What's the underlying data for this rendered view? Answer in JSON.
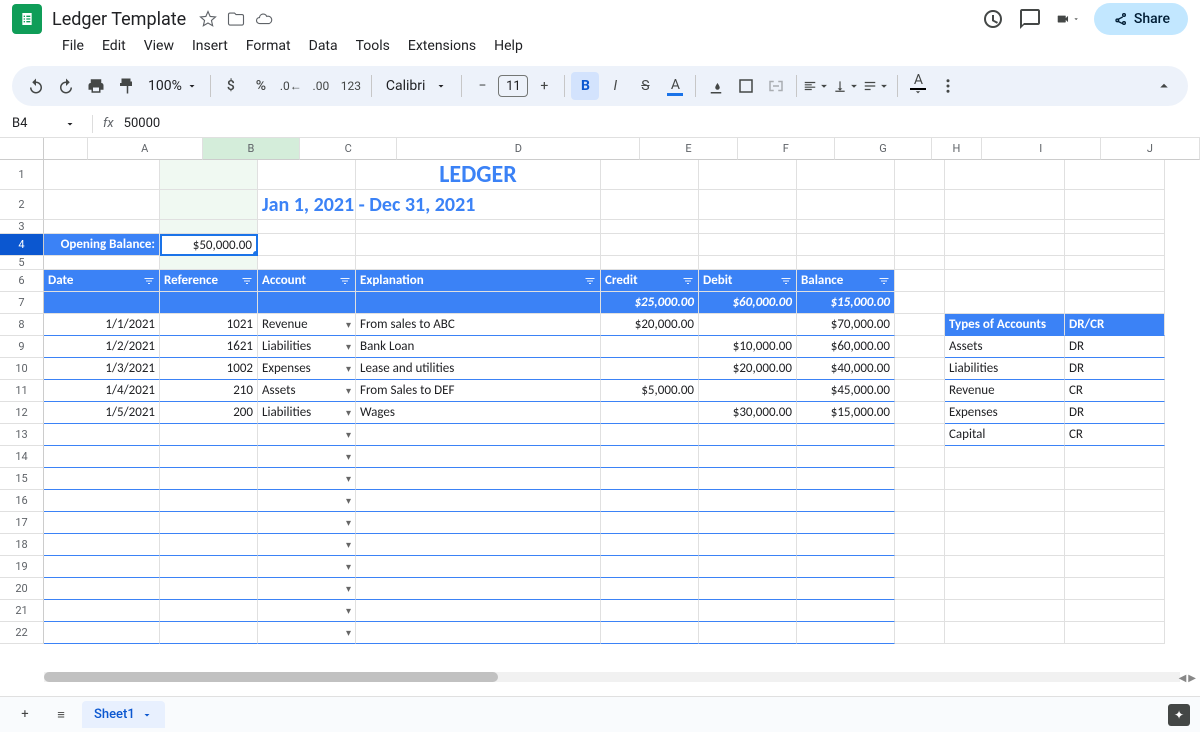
{
  "doc": {
    "title": "Ledger Template"
  },
  "menus": [
    "File",
    "Edit",
    "View",
    "Insert",
    "Format",
    "Data",
    "Tools",
    "Extensions",
    "Help"
  ],
  "toolbar": {
    "zoom": "100%",
    "font": "Calibri",
    "font_size": "11"
  },
  "share": "Share",
  "namebox": "B4",
  "formula": "50000",
  "fx": "fx",
  "cols": [
    "A",
    "B",
    "C",
    "D",
    "E",
    "F",
    "G",
    "H",
    "I",
    "J"
  ],
  "sheet": {
    "name": "Sheet1"
  },
  "content": {
    "ledger_title": "LEDGER",
    "date_range": "Jan 1, 2021 - Dec 31, 2021",
    "opening_balance_label": "Opening Balance:",
    "opening_balance_value": "$50,000.00",
    "headers": {
      "date": "Date",
      "reference": "Reference",
      "account": "Account",
      "explanation": "Explanation",
      "credit": "Credit",
      "debit": "Debit",
      "balance": "Balance"
    },
    "totals": {
      "credit": "$25,000.00",
      "debit": "$60,000.00",
      "balance": "$15,000.00"
    },
    "rows": [
      {
        "date": "1/1/2021",
        "ref": "1021",
        "account": "Revenue",
        "expl": "From sales to ABC",
        "credit": "$20,000.00",
        "debit": "",
        "balance": "$70,000.00"
      },
      {
        "date": "1/2/2021",
        "ref": "1621",
        "account": "Liabilities",
        "expl": "Bank Loan",
        "credit": "",
        "debit": "$10,000.00",
        "balance": "$60,000.00"
      },
      {
        "date": "1/3/2021",
        "ref": "1002",
        "account": "Expenses",
        "expl": "Lease and utilities",
        "credit": "",
        "debit": "$20,000.00",
        "balance": "$40,000.00"
      },
      {
        "date": "1/4/2021",
        "ref": "210",
        "account": "Assets",
        "expl": "From Sales to DEF",
        "credit": "$5,000.00",
        "debit": "",
        "balance": "$45,000.00"
      },
      {
        "date": "1/5/2021",
        "ref": "200",
        "account": "Liabilities",
        "expl": "Wages",
        "credit": "",
        "debit": "$30,000.00",
        "balance": "$15,000.00"
      }
    ],
    "side_table": {
      "h1": "Types of Accounts",
      "h2": "DR/CR",
      "rows": [
        {
          "t": "Assets",
          "v": "DR"
        },
        {
          "t": "Liabilities",
          "v": "DR"
        },
        {
          "t": "Revenue",
          "v": "CR"
        },
        {
          "t": "Expenses",
          "v": "DR"
        },
        {
          "t": "Capital",
          "v": "CR"
        }
      ]
    }
  }
}
